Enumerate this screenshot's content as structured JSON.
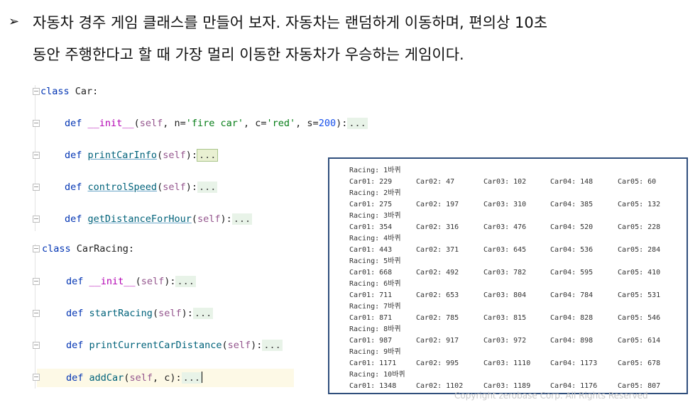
{
  "intro": {
    "bullet": "➢",
    "line1": "자동차 경주 게임 클래스를 만들어 보자. 자동차는 랜덤하게 이동하며, 편의상 10초",
    "line2": "동안 주행한다고 할 때 가장 멀리 이동한 자동차가 우승하는 게임이다."
  },
  "code": {
    "class_kw": "class",
    "ellipsis": "...",
    "car_class": "Car:",
    "car_init": "__init__",
    "car_init_args_a": "(self, n=",
    "car_init_n": "'fire car'",
    "car_init_args_b": ", c=",
    "car_init_c": "'red'",
    "car_init_args_c": ", s=",
    "car_init_s": "200",
    "car_init_args_d": "):",
    "def_kw": "def",
    "self_kw": "self",
    "print_car_info": "printCarInfo",
    "control_speed": "controlSpeed",
    "get_distance": "getDistanceForHour",
    "racing_class": "CarRacing:",
    "racing_init": "__init__",
    "start_racing": "startRacing",
    "print_distance": "printCurrentCarDistance",
    "add_car": "addCar",
    "add_car_args": "(self, c):",
    "open_paren": "(",
    "close_colon": "):"
  },
  "console": {
    "rounds": [
      {
        "label": "Racing: 1바퀴",
        "cars": [
          "Car01: 229",
          "Car02: 47",
          "Car03: 102",
          "Car04: 148",
          "Car05: 60"
        ]
      },
      {
        "label": "Racing: 2바퀴",
        "cars": [
          "Car01: 275",
          "Car02: 197",
          "Car03: 310",
          "Car04: 385",
          "Car05: 132"
        ]
      },
      {
        "label": "Racing: 3바퀴",
        "cars": [
          "Car01: 354",
          "Car02: 316",
          "Car03: 476",
          "Car04: 520",
          "Car05: 228"
        ]
      },
      {
        "label": "Racing: 4바퀴",
        "cars": [
          "Car01: 443",
          "Car02: 371",
          "Car03: 645",
          "Car04: 536",
          "Car05: 284"
        ]
      },
      {
        "label": "Racing: 5바퀴",
        "cars": [
          "Car01: 668",
          "Car02: 492",
          "Car03: 782",
          "Car04: 595",
          "Car05: 410"
        ]
      },
      {
        "label": "Racing: 6바퀴",
        "cars": [
          "Car01: 711",
          "Car02: 653",
          "Car03: 804",
          "Car04: 784",
          "Car05: 531"
        ]
      },
      {
        "label": "Racing: 7바퀴",
        "cars": [
          "Car01: 871",
          "Car02: 785",
          "Car03: 815",
          "Car04: 828",
          "Car05: 546"
        ]
      },
      {
        "label": "Racing: 8바퀴",
        "cars": [
          "Car01: 987",
          "Car02: 917",
          "Car03: 972",
          "Car04: 898",
          "Car05: 614"
        ]
      },
      {
        "label": "Racing: 9바퀴",
        "cars": [
          "Car01: 1171",
          "Car02: 995",
          "Car03: 1110",
          "Car04: 1173",
          "Car05: 678"
        ]
      },
      {
        "label": "Racing: 10바퀴",
        "cars": [
          "Car01: 1348",
          "Car02: 1102",
          "Car03: 1189",
          "Car04: 1176",
          "Car05: 807"
        ]
      }
    ]
  },
  "footer": {
    "copyright": "Copyright zerobase Corp. All Rights Reserved"
  }
}
